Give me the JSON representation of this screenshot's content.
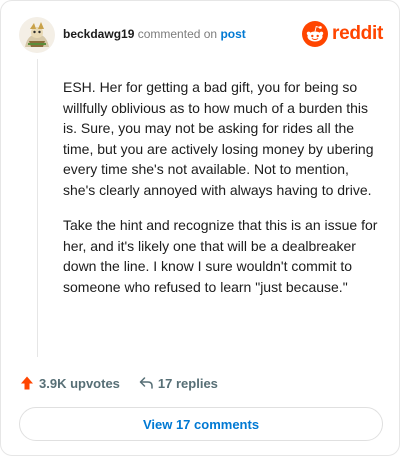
{
  "comment": {
    "username": "beckdawg19",
    "action_text": "commented on",
    "post_link": "post",
    "paragraphs": [
      "ESH. Her for getting a bad gift, you for being so willfully oblivious as to how much of a burden this is. Sure, you may not be asking for rides all the time, but you are actively losing money by ubering every time she's not available. Not to mention, she's clearly annoyed with always having to drive.",
      "Take the hint and recognize that this is an issue for her, and it's likely one that will be a dealbreaker down the line. I know I sure wouldn't commit to someone who refused to learn \"just because.\""
    ],
    "upvotes": "3.9K upvotes",
    "replies": "17 replies",
    "view_button": "View 17 comments"
  },
  "brand": {
    "name": "reddit",
    "color": "#ff4500"
  },
  "colors": {
    "link": "#0079d3",
    "meta": "#576f76",
    "upvote": "#ff4500"
  },
  "icons": {
    "avatar": "snoo-avatar",
    "upvote": "upvote-arrow-icon",
    "reply": "reply-arrow-icon",
    "brand": "reddit-logo-icon"
  }
}
